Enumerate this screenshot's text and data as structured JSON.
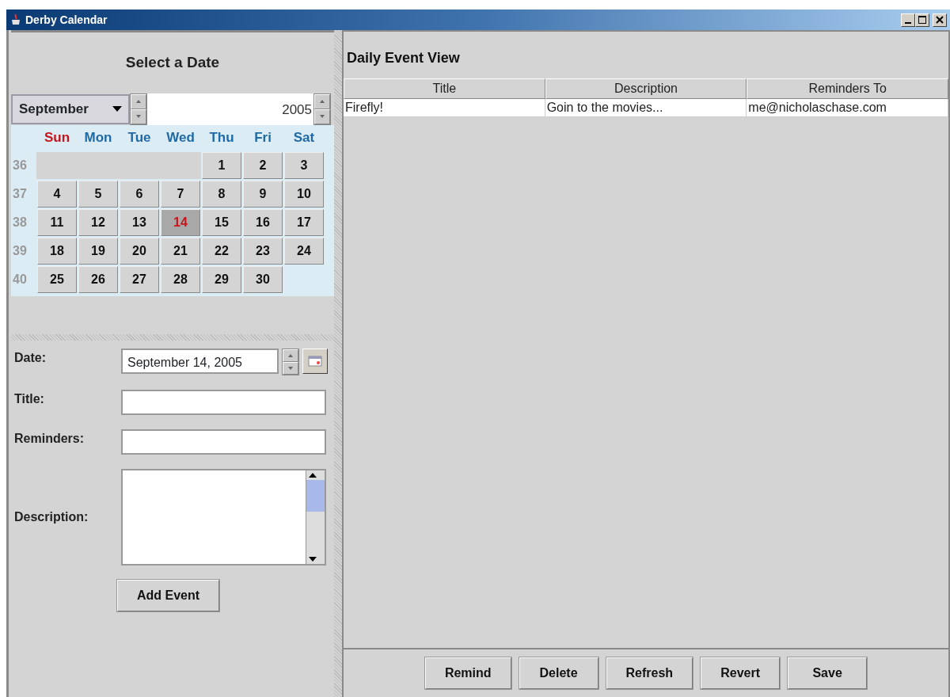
{
  "window": {
    "title": "Derby Calendar"
  },
  "date_picker": {
    "heading": "Select a Date",
    "month": "September",
    "year": "2005",
    "weekdays": [
      {
        "label": "Sun",
        "kind": "sunday"
      },
      {
        "label": "Mon",
        "kind": "weekday"
      },
      {
        "label": "Tue",
        "kind": "weekday"
      },
      {
        "label": "Wed",
        "kind": "weekday"
      },
      {
        "label": "Thu",
        "kind": "weekday"
      },
      {
        "label": "Fri",
        "kind": "weekday"
      },
      {
        "label": "Sat",
        "kind": "weekday"
      }
    ],
    "weeks": [
      {
        "number": "36",
        "days": [
          {
            "kind": "blank"
          },
          {
            "kind": "blank"
          },
          {
            "kind": "blank"
          },
          {
            "kind": "blank"
          },
          {
            "kind": "day",
            "label": "1",
            "selected": false
          },
          {
            "kind": "day",
            "label": "2",
            "selected": false
          },
          {
            "kind": "day",
            "label": "3",
            "selected": false
          }
        ]
      },
      {
        "number": "37",
        "days": [
          {
            "kind": "day",
            "label": "4",
            "selected": false
          },
          {
            "kind": "day",
            "label": "5",
            "selected": false
          },
          {
            "kind": "day",
            "label": "6",
            "selected": false
          },
          {
            "kind": "day",
            "label": "7",
            "selected": false
          },
          {
            "kind": "day",
            "label": "8",
            "selected": false
          },
          {
            "kind": "day",
            "label": "9",
            "selected": false
          },
          {
            "kind": "day",
            "label": "10",
            "selected": false
          }
        ]
      },
      {
        "number": "38",
        "days": [
          {
            "kind": "day",
            "label": "11",
            "selected": false
          },
          {
            "kind": "day",
            "label": "12",
            "selected": false
          },
          {
            "kind": "day",
            "label": "13",
            "selected": false
          },
          {
            "kind": "day",
            "label": "14",
            "selected": true
          },
          {
            "kind": "day",
            "label": "15",
            "selected": false
          },
          {
            "kind": "day",
            "label": "16",
            "selected": false
          },
          {
            "kind": "day",
            "label": "17",
            "selected": false
          }
        ]
      },
      {
        "number": "39",
        "days": [
          {
            "kind": "day",
            "label": "18",
            "selected": false
          },
          {
            "kind": "day",
            "label": "19",
            "selected": false
          },
          {
            "kind": "day",
            "label": "20",
            "selected": false
          },
          {
            "kind": "day",
            "label": "21",
            "selected": false
          },
          {
            "kind": "day",
            "label": "22",
            "selected": false
          },
          {
            "kind": "day",
            "label": "23",
            "selected": false
          },
          {
            "kind": "day",
            "label": "24",
            "selected": false
          }
        ]
      },
      {
        "number": "40",
        "days": [
          {
            "kind": "day",
            "label": "25",
            "selected": false
          },
          {
            "kind": "day",
            "label": "26",
            "selected": false
          },
          {
            "kind": "day",
            "label": "27",
            "selected": false
          },
          {
            "kind": "day",
            "label": "28",
            "selected": false
          },
          {
            "kind": "day",
            "label": "29",
            "selected": false
          },
          {
            "kind": "day",
            "label": "30",
            "selected": false
          }
        ]
      }
    ]
  },
  "form": {
    "fields": [
      {
        "label": "Date:",
        "kind": "date",
        "value": "September 14, 2005"
      },
      {
        "label": "Title:",
        "kind": "text"
      },
      {
        "label": "Reminders:",
        "kind": "text"
      },
      {
        "label": "Description:",
        "kind": "textarea"
      }
    ],
    "button": "Add Event"
  },
  "event_view": {
    "heading": "Daily Event View",
    "columns": [
      "Title",
      "Description",
      "Reminders To"
    ],
    "rows": [
      [
        "Firefly!",
        "Goin to the movies...",
        "me@nicholaschase.com"
      ]
    ],
    "buttons": [
      "Remind",
      "Delete",
      "Refresh",
      "Revert",
      "Save"
    ]
  }
}
